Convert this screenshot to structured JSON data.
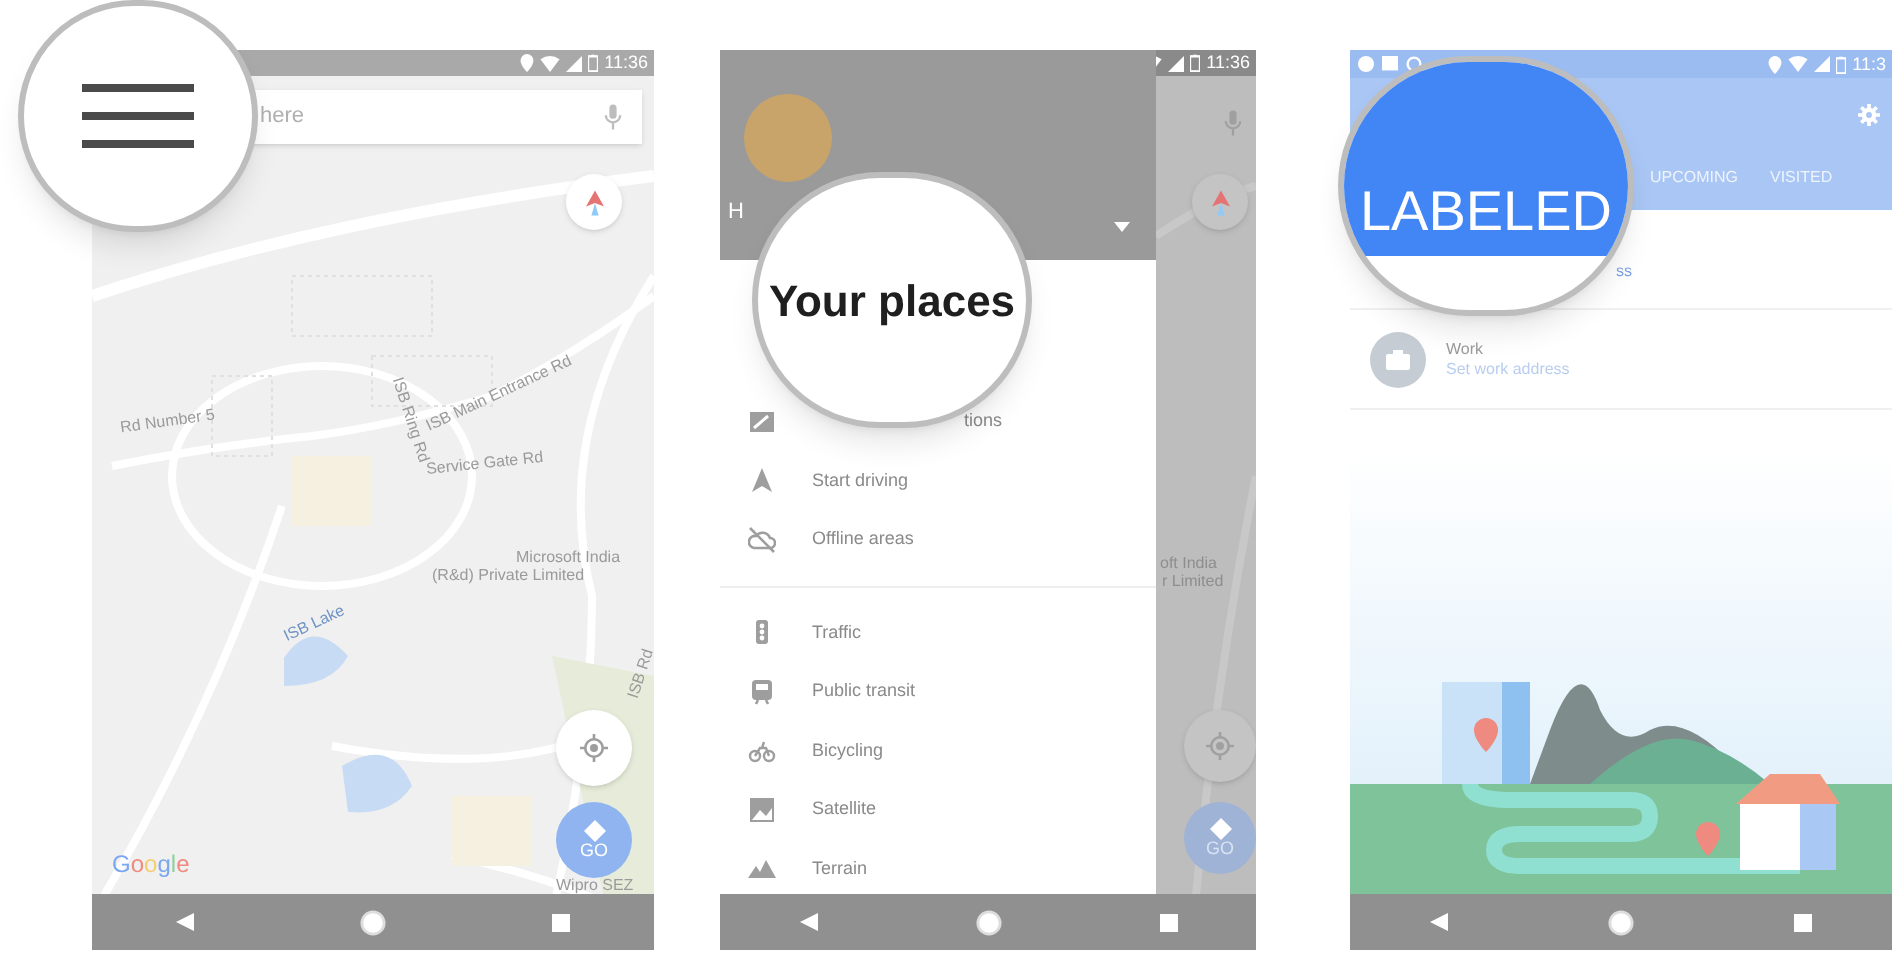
{
  "phones": [
    {
      "kind": "map",
      "status_bar": {
        "time": "11:36"
      },
      "magnifier": {
        "kind": "menu"
      },
      "search": {
        "placeholder": "here"
      },
      "map_labels": [
        "Rd Number 5",
        "ISB Main Entrance Rd",
        "ISB Ring Rd",
        "Service Gate Rd",
        "Microsoft India",
        "(R&d) Private Limited",
        "ISB Lake",
        "ISB Rd",
        "Wipro SEZ"
      ],
      "logo": "Google",
      "go_button": {
        "label": "GO"
      }
    },
    {
      "kind": "drawer",
      "status_bar": {
        "time": "11:36"
      },
      "magnifier": {
        "kind": "label",
        "text": "Your places"
      },
      "account": {
        "name": "H"
      },
      "menu_groups": [
        {
          "items": [
            {
              "label": "tions"
            },
            {
              "label": "Start driving"
            },
            {
              "label": "Offline areas"
            }
          ]
        },
        {
          "items": [
            {
              "label": "Traffic"
            },
            {
              "label": "Public transit"
            },
            {
              "label": "Bicycling"
            },
            {
              "label": "Satellite"
            },
            {
              "label": "Terrain"
            }
          ]
        }
      ],
      "map_labels": [
        "oft India",
        "r Limited"
      ],
      "go_button": {
        "label": "GO"
      }
    },
    {
      "kind": "saved",
      "status_bar": {
        "time": "11:3"
      },
      "magnifier": {
        "kind": "tab"
      },
      "tabs": [
        {
          "label": "LABELED",
          "selected": true
        },
        {
          "label": "UPCOMING",
          "selected": false
        },
        {
          "label": "VISITED",
          "selected": false
        }
      ],
      "places": [
        {
          "address": "ss"
        },
        {
          "name": "Work",
          "address": "Set work address"
        }
      ]
    }
  ]
}
